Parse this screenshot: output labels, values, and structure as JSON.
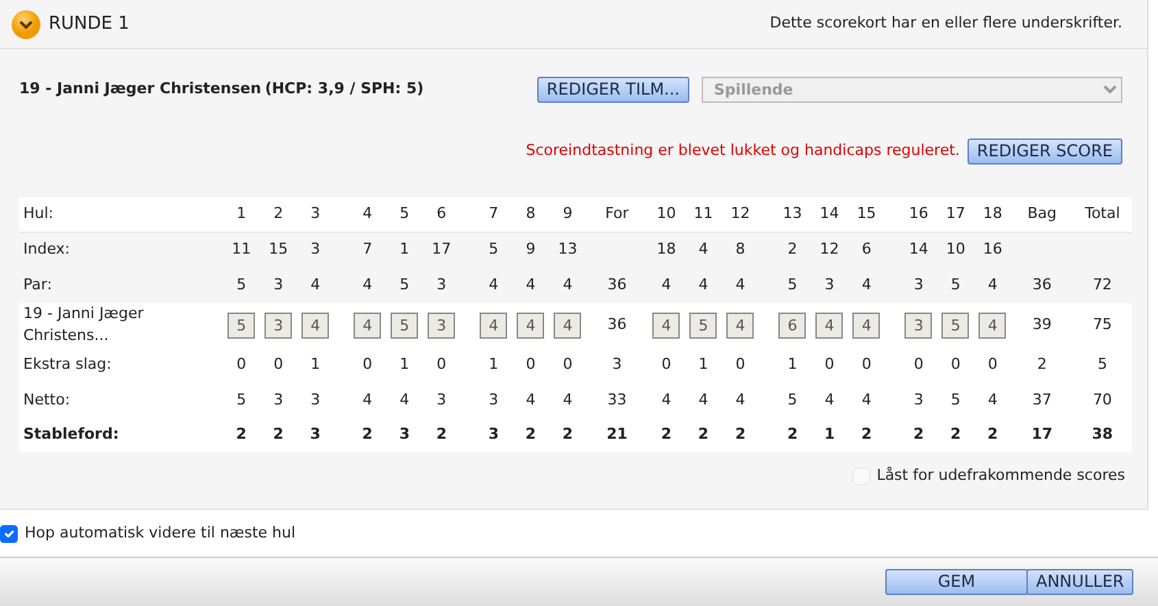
{
  "round": {
    "title": "RUNDE 1",
    "expanded": true,
    "signature_note": "Dette scorekort har en eller flere underskrifter."
  },
  "player": {
    "name": "19 - Janni Jæger Christensen",
    "hcp": "(HCP: 3,9 / SPH: 5)",
    "edit_button": "REDIGER TILM...",
    "status_select": "Spillende",
    "status_disabled": true
  },
  "message": "Scoreindtastning er blevet lukket og handicaps reguleret.",
  "edit_score_button": "REDIGER SCORE",
  "header_label": "Hul:",
  "columns": [
    {
      "label": "1",
      "kind": "hole"
    },
    {
      "label": "2",
      "kind": "hole"
    },
    {
      "label": "3",
      "kind": "hole"
    },
    {
      "label": "4",
      "kind": "hole"
    },
    {
      "label": "5",
      "kind": "hole"
    },
    {
      "label": "6",
      "kind": "hole"
    },
    {
      "label": "7",
      "kind": "hole"
    },
    {
      "label": "8",
      "kind": "hole"
    },
    {
      "label": "9",
      "kind": "hole"
    },
    {
      "label": "For",
      "kind": "sum"
    },
    {
      "label": "10",
      "kind": "hole"
    },
    {
      "label": "11",
      "kind": "hole"
    },
    {
      "label": "12",
      "kind": "hole"
    },
    {
      "label": "13",
      "kind": "hole"
    },
    {
      "label": "14",
      "kind": "hole"
    },
    {
      "label": "15",
      "kind": "hole"
    },
    {
      "label": "16",
      "kind": "hole"
    },
    {
      "label": "17",
      "kind": "hole"
    },
    {
      "label": "18",
      "kind": "hole"
    },
    {
      "label": "Bag",
      "kind": "sum"
    },
    {
      "label": "Total",
      "kind": "sum"
    }
  ],
  "rows": [
    {
      "label": "Index:",
      "kind": "course",
      "cells": [
        "11",
        "15",
        "3",
        "7",
        "1",
        "17",
        "5",
        "9",
        "13",
        null,
        "18",
        "4",
        "8",
        "2",
        "12",
        "6",
        "14",
        "10",
        "16",
        null,
        null
      ]
    },
    {
      "label": "Par:",
      "kind": "course",
      "cells": [
        "5",
        "3",
        "4",
        "4",
        "5",
        "3",
        "4",
        "4",
        "4",
        "36",
        "4",
        "4",
        "4",
        "5",
        "3",
        "4",
        "3",
        "5",
        "4",
        "36",
        "72"
      ]
    },
    {
      "label": "19 - Janni Jæger Christens...",
      "kind": "score",
      "cells": [
        "5",
        "3",
        "4",
        "4",
        "5",
        "3",
        "4",
        "4",
        "4",
        "36",
        "4",
        "5",
        "4",
        "6",
        "4",
        "4",
        "3",
        "5",
        "4",
        "39",
        "75"
      ]
    },
    {
      "label": "Ekstra slag:",
      "kind": "result",
      "cells": [
        "0",
        "0",
        "1",
        "0",
        "1",
        "0",
        "1",
        "0",
        "0",
        "3",
        "0",
        "1",
        "0",
        "1",
        "0",
        "0",
        "0",
        "0",
        "0",
        "2",
        "5"
      ]
    },
    {
      "label": "Netto:",
      "kind": "result",
      "cells": [
        "5",
        "3",
        "3",
        "4",
        "4",
        "3",
        "3",
        "4",
        "4",
        "33",
        "4",
        "4",
        "4",
        "5",
        "4",
        "4",
        "3",
        "5",
        "4",
        "37",
        "70"
      ]
    },
    {
      "label": "Stableford:",
      "kind": "total",
      "cells": [
        "2",
        "2",
        "3",
        "2",
        "3",
        "2",
        "3",
        "2",
        "2",
        "21",
        "2",
        "2",
        "2",
        "2",
        "1",
        "2",
        "2",
        "2",
        "2",
        "17",
        "38"
      ]
    }
  ],
  "locked": {
    "label": "Låst for udefrakommende scores",
    "checked": false,
    "disabled": true
  },
  "auto_advance": {
    "label": "Hop automatisk videre til næste hul",
    "checked": true
  },
  "buttons": [
    "GEM",
    "ANNULLER"
  ]
}
